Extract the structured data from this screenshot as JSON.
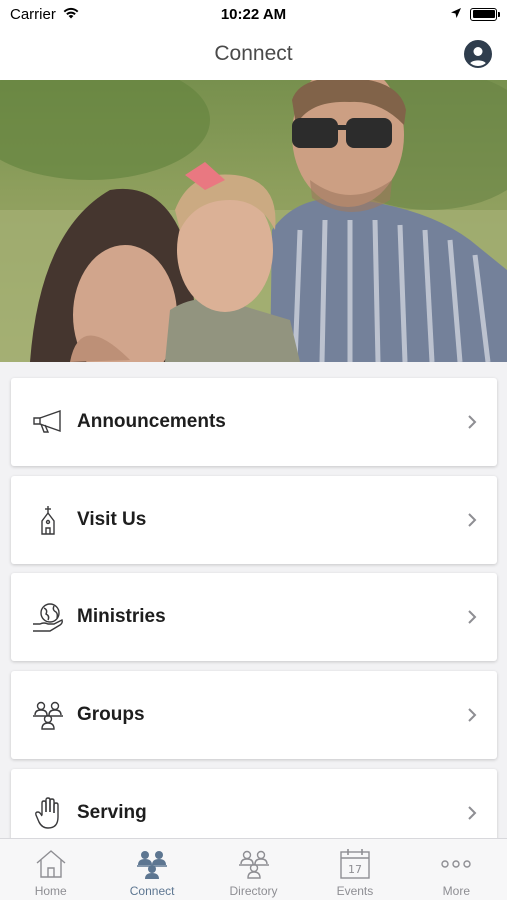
{
  "status_bar": {
    "carrier": "Carrier",
    "time": "10:22 AM",
    "icons": [
      "wifi-icon",
      "location-icon",
      "battery-icon"
    ]
  },
  "nav": {
    "title": "Connect",
    "profile_icon": "user-profile-icon"
  },
  "hero": {
    "image_description_icon": "family-photo"
  },
  "menu": {
    "items": [
      {
        "label": "Announcements",
        "icon": "megaphone-icon"
      },
      {
        "label": "Visit Us",
        "icon": "church-icon"
      },
      {
        "label": "Ministries",
        "icon": "globe-hand-icon"
      },
      {
        "label": "Groups",
        "icon": "group-people-icon"
      },
      {
        "label": "Serving",
        "icon": "raised-hand-icon"
      }
    ]
  },
  "tabs": {
    "items": [
      {
        "label": "Home",
        "icon": "home-icon",
        "active": false
      },
      {
        "label": "Connect",
        "icon": "connect-people-icon",
        "active": true
      },
      {
        "label": "Directory",
        "icon": "directory-people-icon",
        "active": false
      },
      {
        "label": "Events",
        "icon": "calendar-icon",
        "active": false,
        "badge": "17"
      },
      {
        "label": "More",
        "icon": "more-dots-icon",
        "active": false
      }
    ]
  },
  "colors": {
    "accent": "#5d7691",
    "inactive_tab": "#8e8e93",
    "profile": "#2f3d4d"
  }
}
